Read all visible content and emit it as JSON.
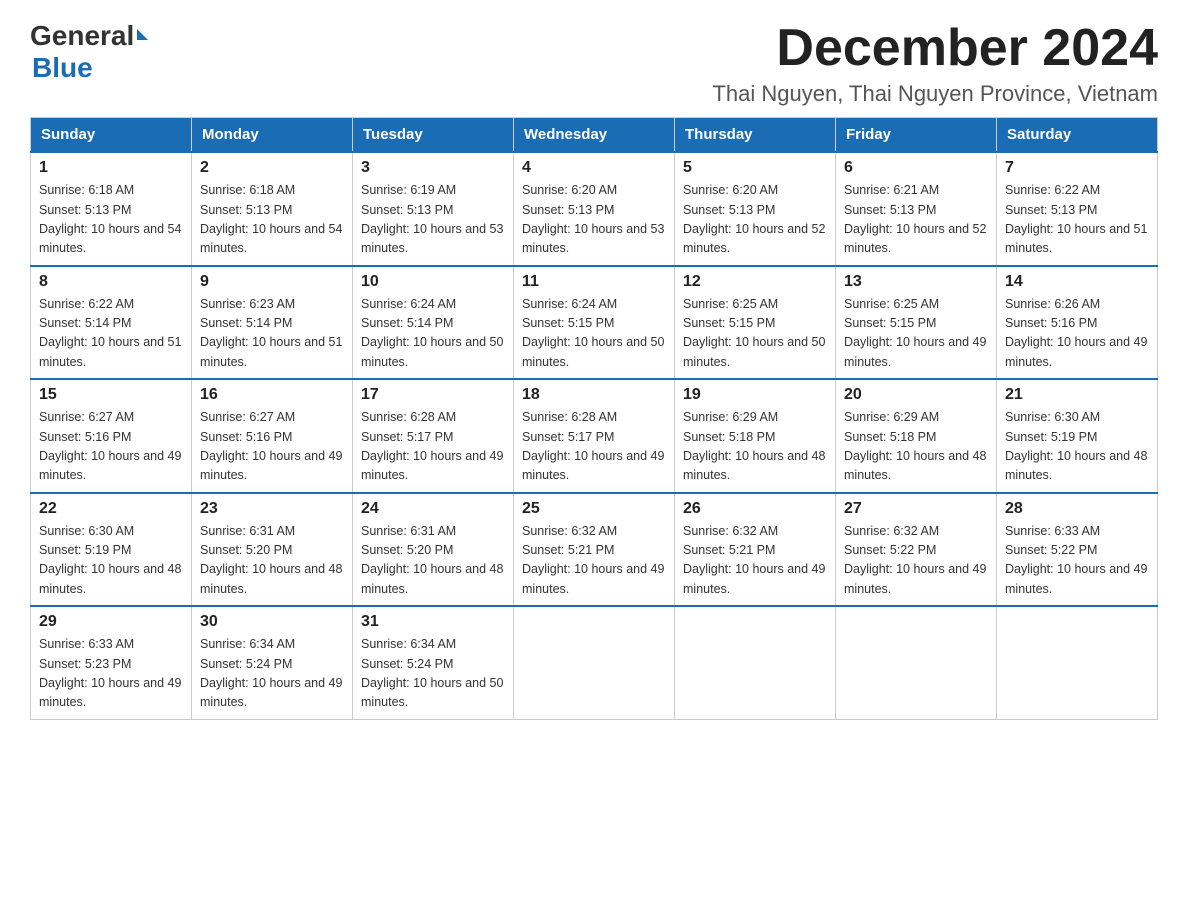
{
  "logo": {
    "general": "General",
    "blue": "Blue"
  },
  "header": {
    "month_year": "December 2024",
    "location": "Thai Nguyen, Thai Nguyen Province, Vietnam"
  },
  "days_of_week": [
    "Sunday",
    "Monday",
    "Tuesday",
    "Wednesday",
    "Thursday",
    "Friday",
    "Saturday"
  ],
  "weeks": [
    [
      {
        "day": "1",
        "sunrise": "6:18 AM",
        "sunset": "5:13 PM",
        "daylight": "10 hours and 54 minutes."
      },
      {
        "day": "2",
        "sunrise": "6:18 AM",
        "sunset": "5:13 PM",
        "daylight": "10 hours and 54 minutes."
      },
      {
        "day": "3",
        "sunrise": "6:19 AM",
        "sunset": "5:13 PM",
        "daylight": "10 hours and 53 minutes."
      },
      {
        "day": "4",
        "sunrise": "6:20 AM",
        "sunset": "5:13 PM",
        "daylight": "10 hours and 53 minutes."
      },
      {
        "day": "5",
        "sunrise": "6:20 AM",
        "sunset": "5:13 PM",
        "daylight": "10 hours and 52 minutes."
      },
      {
        "day": "6",
        "sunrise": "6:21 AM",
        "sunset": "5:13 PM",
        "daylight": "10 hours and 52 minutes."
      },
      {
        "day": "7",
        "sunrise": "6:22 AM",
        "sunset": "5:13 PM",
        "daylight": "10 hours and 51 minutes."
      }
    ],
    [
      {
        "day": "8",
        "sunrise": "6:22 AM",
        "sunset": "5:14 PM",
        "daylight": "10 hours and 51 minutes."
      },
      {
        "day": "9",
        "sunrise": "6:23 AM",
        "sunset": "5:14 PM",
        "daylight": "10 hours and 51 minutes."
      },
      {
        "day": "10",
        "sunrise": "6:24 AM",
        "sunset": "5:14 PM",
        "daylight": "10 hours and 50 minutes."
      },
      {
        "day": "11",
        "sunrise": "6:24 AM",
        "sunset": "5:15 PM",
        "daylight": "10 hours and 50 minutes."
      },
      {
        "day": "12",
        "sunrise": "6:25 AM",
        "sunset": "5:15 PM",
        "daylight": "10 hours and 50 minutes."
      },
      {
        "day": "13",
        "sunrise": "6:25 AM",
        "sunset": "5:15 PM",
        "daylight": "10 hours and 49 minutes."
      },
      {
        "day": "14",
        "sunrise": "6:26 AM",
        "sunset": "5:16 PM",
        "daylight": "10 hours and 49 minutes."
      }
    ],
    [
      {
        "day": "15",
        "sunrise": "6:27 AM",
        "sunset": "5:16 PM",
        "daylight": "10 hours and 49 minutes."
      },
      {
        "day": "16",
        "sunrise": "6:27 AM",
        "sunset": "5:16 PM",
        "daylight": "10 hours and 49 minutes."
      },
      {
        "day": "17",
        "sunrise": "6:28 AM",
        "sunset": "5:17 PM",
        "daylight": "10 hours and 49 minutes."
      },
      {
        "day": "18",
        "sunrise": "6:28 AM",
        "sunset": "5:17 PM",
        "daylight": "10 hours and 49 minutes."
      },
      {
        "day": "19",
        "sunrise": "6:29 AM",
        "sunset": "5:18 PM",
        "daylight": "10 hours and 48 minutes."
      },
      {
        "day": "20",
        "sunrise": "6:29 AM",
        "sunset": "5:18 PM",
        "daylight": "10 hours and 48 minutes."
      },
      {
        "day": "21",
        "sunrise": "6:30 AM",
        "sunset": "5:19 PM",
        "daylight": "10 hours and 48 minutes."
      }
    ],
    [
      {
        "day": "22",
        "sunrise": "6:30 AM",
        "sunset": "5:19 PM",
        "daylight": "10 hours and 48 minutes."
      },
      {
        "day": "23",
        "sunrise": "6:31 AM",
        "sunset": "5:20 PM",
        "daylight": "10 hours and 48 minutes."
      },
      {
        "day": "24",
        "sunrise": "6:31 AM",
        "sunset": "5:20 PM",
        "daylight": "10 hours and 48 minutes."
      },
      {
        "day": "25",
        "sunrise": "6:32 AM",
        "sunset": "5:21 PM",
        "daylight": "10 hours and 49 minutes."
      },
      {
        "day": "26",
        "sunrise": "6:32 AM",
        "sunset": "5:21 PM",
        "daylight": "10 hours and 49 minutes."
      },
      {
        "day": "27",
        "sunrise": "6:32 AM",
        "sunset": "5:22 PM",
        "daylight": "10 hours and 49 minutes."
      },
      {
        "day": "28",
        "sunrise": "6:33 AM",
        "sunset": "5:22 PM",
        "daylight": "10 hours and 49 minutes."
      }
    ],
    [
      {
        "day": "29",
        "sunrise": "6:33 AM",
        "sunset": "5:23 PM",
        "daylight": "10 hours and 49 minutes."
      },
      {
        "day": "30",
        "sunrise": "6:34 AM",
        "sunset": "5:24 PM",
        "daylight": "10 hours and 49 minutes."
      },
      {
        "day": "31",
        "sunrise": "6:34 AM",
        "sunset": "5:24 PM",
        "daylight": "10 hours and 50 minutes."
      },
      null,
      null,
      null,
      null
    ]
  ]
}
